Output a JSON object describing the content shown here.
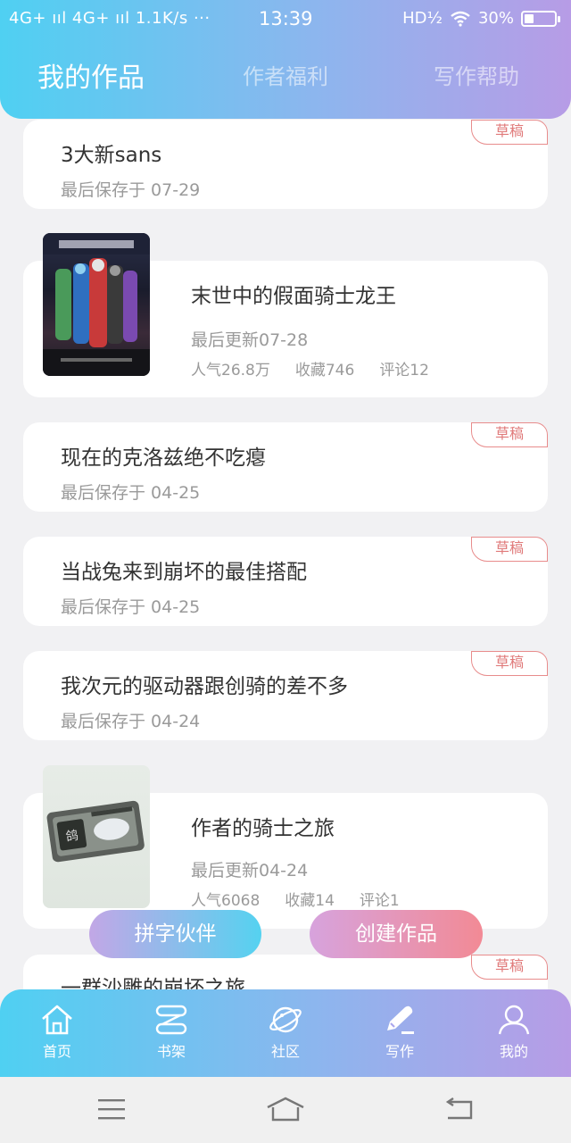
{
  "status": {
    "left": "4G+ ııl 4G+ ııl 1.1K/s ···",
    "time": "13:39",
    "right_text": "HD½",
    "battery": "30%"
  },
  "tabs": [
    {
      "label": "我的作品",
      "active": true
    },
    {
      "label": "作者福利",
      "active": false
    },
    {
      "label": "写作帮助",
      "active": false
    }
  ],
  "works": [
    {
      "type": "draft",
      "title": "3大新sans",
      "meta": "最后保存于 07-29",
      "badge": "草稿"
    },
    {
      "type": "book",
      "title": "末世中的假面骑士龙王",
      "meta": "最后更新07-28",
      "popularity": "人气26.8万",
      "favorites": "收藏746",
      "comments": "评论12"
    },
    {
      "type": "draft",
      "title": "现在的克洛兹绝不吃瘪",
      "meta": "最后保存于 04-25",
      "badge": "草稿"
    },
    {
      "type": "draft",
      "title": "当战兔来到崩坏的最佳搭配",
      "meta": "最后保存于 04-25",
      "badge": "草稿"
    },
    {
      "type": "draft",
      "title": "我次元的驱动器跟创骑的差不多",
      "meta": "最后保存于 04-24",
      "badge": "草稿"
    },
    {
      "type": "book",
      "title": "作者的骑士之旅",
      "meta": "最后更新04-24",
      "popularity": "人气6068",
      "favorites": "收藏14",
      "comments": "评论1"
    },
    {
      "type": "draft",
      "title": "一群沙雕的崩坏之旅",
      "meta": "",
      "badge": "草稿"
    }
  ],
  "actions": {
    "partner": "拼字伙伴",
    "create": "创建作品"
  },
  "bottom_nav": [
    {
      "label": "首页",
      "icon": "home-icon"
    },
    {
      "label": "书架",
      "icon": "bookshelf-icon"
    },
    {
      "label": "社区",
      "icon": "planet-icon"
    },
    {
      "label": "写作",
      "icon": "pen-icon"
    },
    {
      "label": "我的",
      "icon": "user-icon"
    }
  ],
  "colors": {
    "accent_start": "#4fd0f2",
    "accent_end": "#b79ce6",
    "badge": "#e07a7a"
  }
}
